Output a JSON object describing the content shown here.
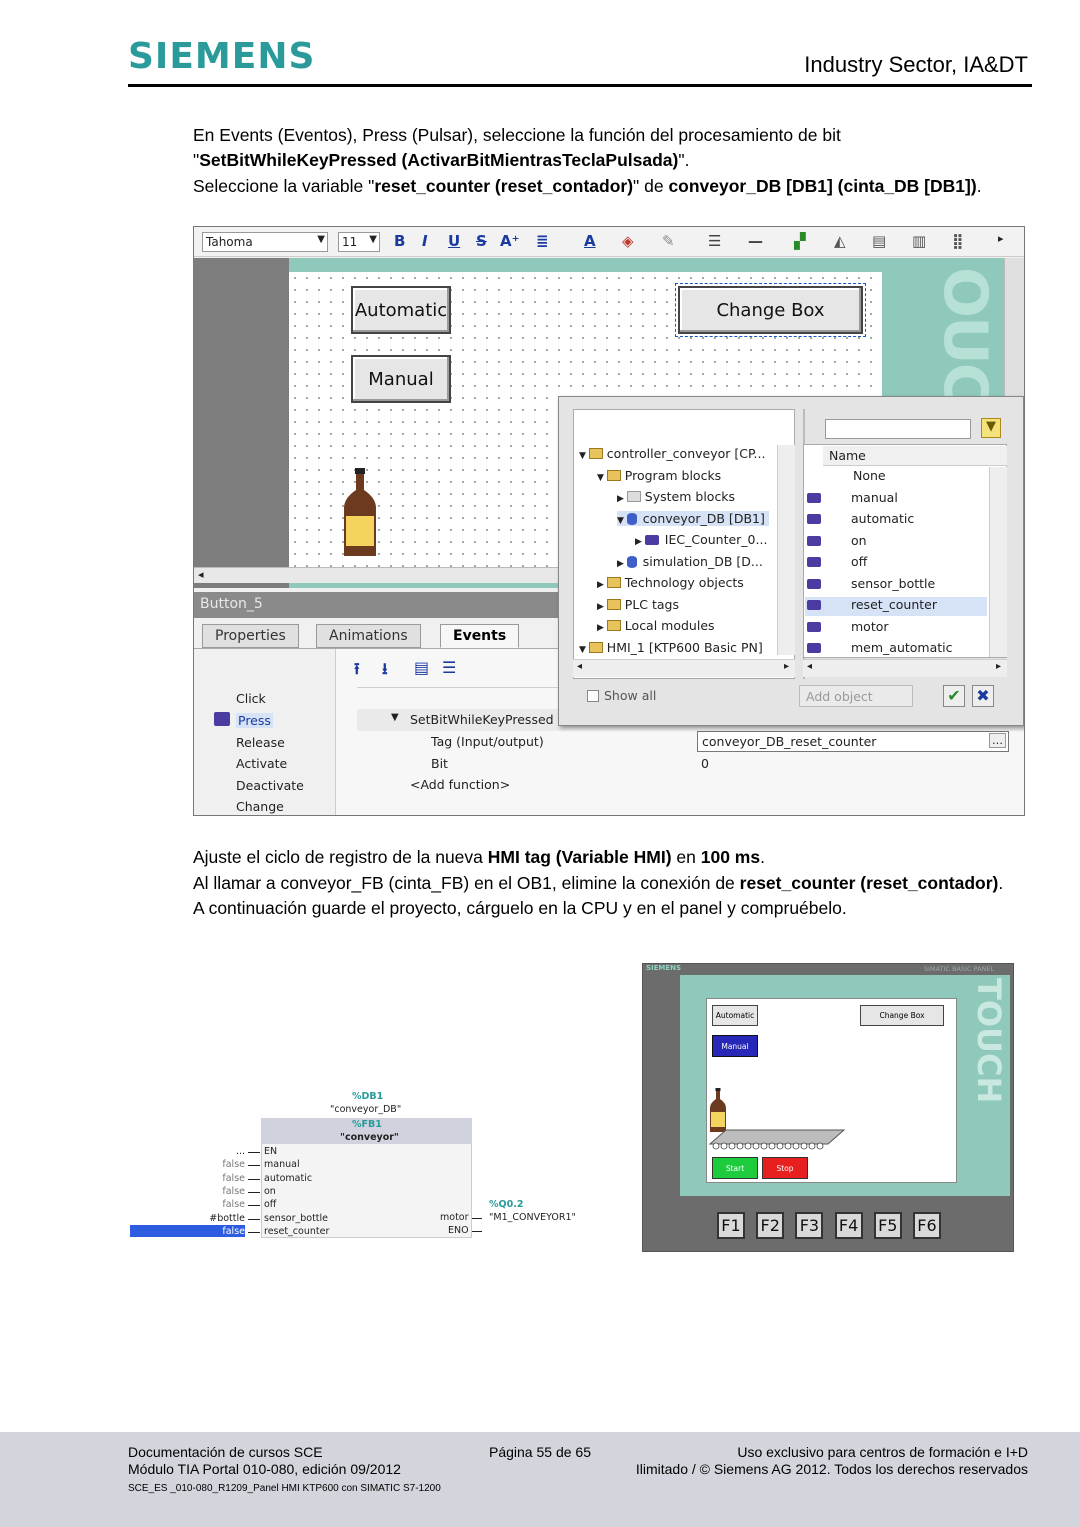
{
  "header": {
    "logo": "SIEMENS",
    "sector": "Industry Sector, IA&DT"
  },
  "intro": {
    "line1": "En Events (Eventos), Press (Pulsar), seleccione la función del procesamiento de bit",
    "line2_q1": "\"",
    "line2_bold": "SetBitWhileKeyPressed (ActivarBitMientrasTeclaPulsada)",
    "line2_q2": "\".",
    "line3_a": "Seleccione la variable \"",
    "line3_b": "reset_counter (reset_contador)",
    "line3_c": "\" de ",
    "line3_d": "conveyor_DB [DB1] (cinta_DB [DB1])",
    "line3_e": "."
  },
  "tia": {
    "toolbar": {
      "font": "Tahoma",
      "size": "11"
    },
    "buttons": {
      "automatic": "Automatic",
      "change_box": "Change Box",
      "manual": "Manual"
    },
    "inspector_title": "Button_5",
    "tabs": {
      "properties": "Properties",
      "animations": "Animations",
      "events": "Events"
    },
    "events": {
      "click": "Click",
      "press": "Press",
      "release": "Release",
      "activate": "Activate",
      "deactivate": "Deactivate",
      "change": "Change"
    },
    "function_rows": {
      "func": "SetBitWhileKeyPressed",
      "tag_label": "Tag (Input/output)",
      "tag_value": "conveyor_DB_reset_counter",
      "bit_label": "Bit",
      "bit_value": "0",
      "add": "<Add function>"
    },
    "tree": {
      "root": "controller_conveyor [CP...",
      "program_blocks": "Program blocks",
      "system_blocks": "System blocks",
      "conveyor_db": "conveyor_DB [DB1]",
      "iec": "IEC_Counter_0...",
      "simulation_db": "simulation_DB [D...",
      "technology": "Technology objects",
      "plc_tags": "PLC tags",
      "local_modules": "Local modules",
      "hmi": "HMI_1 [KTP600 Basic PN]"
    },
    "list": {
      "header": "Name",
      "items": [
        "None",
        "manual",
        "automatic",
        "on",
        "off",
        "sensor_bottle",
        "reset_counter",
        "motor",
        "mem_automatic"
      ]
    },
    "show_all": "Show all",
    "add_object": "Add object"
  },
  "outro": {
    "l1_a": "Ajuste el ciclo de registro de la nueva ",
    "l1_b": "HMI tag (Variable HMI)",
    "l1_c": " en ",
    "l1_d": "100 ms",
    "l1_e": ".",
    "l2_a": "Al llamar a conveyor_FB (cinta_FB) en el OB1, elimine la conexión de ",
    "l2_b": "reset_counter (reset_contador)",
    "l2_c": ".",
    "l3": "A continuación guarde el proyecto, cárguelo en la CPU y en el panel y compruébelo."
  },
  "fb_block": {
    "db_addr": "%DB1",
    "db_name": "\"conveyor_DB\"",
    "fb_addr": "%FB1",
    "fb_name": "\"conveyor\"",
    "inputs": [
      {
        "value": "...",
        "pin": "EN"
      },
      {
        "value": "false",
        "pin": "manual"
      },
      {
        "value": "false",
        "pin": "automatic"
      },
      {
        "value": "false",
        "pin": "on"
      },
      {
        "value": "false",
        "pin": "off"
      },
      {
        "value": "#bottle",
        "pin": "sensor_bottle"
      },
      {
        "value": "false",
        "pin": "reset_counter"
      }
    ],
    "out_addr": "%Q0.2",
    "out_pin": "motor",
    "out_tag": "\"M1_CONVEYOR1\"",
    "eno": "ENO"
  },
  "panel": {
    "brand": "SIEMENS",
    "model": "SIMATIC BASIC PANEL",
    "touch": "TOUCH",
    "automatic": "Automatic",
    "change_box": "Change Box",
    "manual": "Manual",
    "start": "Start",
    "stop": "Stop",
    "fkeys": [
      "F1",
      "F2",
      "F3",
      "F4",
      "F5",
      "F6"
    ]
  },
  "footer": {
    "left1": "Documentación de cursos SCE",
    "left2": "Módulo TIA Portal 010-080, edición 09/2012",
    "left3": "SCE_ES _010-080_R1209_Panel HMI KTP600 con SIMATIC S7-1200",
    "center": "Página 55 de 65",
    "right1": "Uso exclusivo para centros de formación e I+D",
    "right2": "Ilimitado / © Siemens AG 2012. Todos los derechos reservados"
  }
}
